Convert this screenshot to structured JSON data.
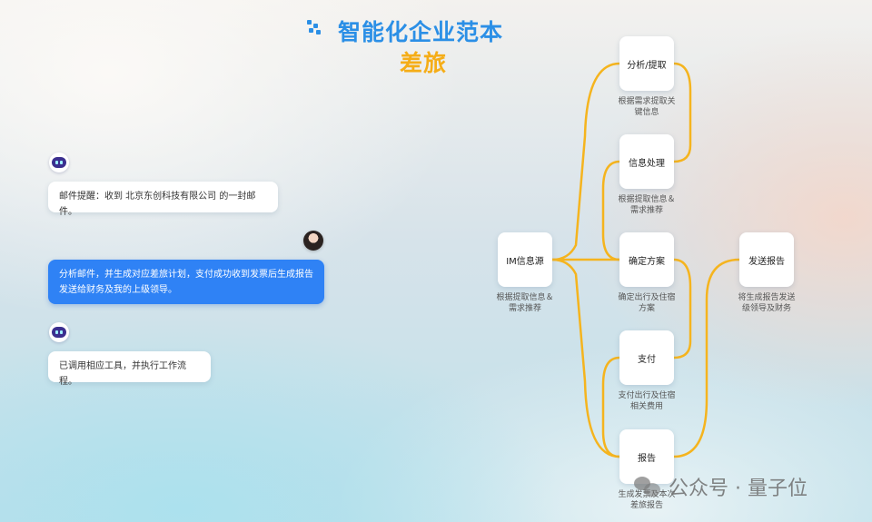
{
  "header": {
    "title": "智能化企业范本",
    "subtitle": "差旅"
  },
  "chat": {
    "messages": [
      {
        "role": "bot",
        "text": "邮件提醒：收到 北京东创科技有限公司 的一封邮件。"
      },
      {
        "role": "user",
        "text_line1": "分析邮件，并生成对应差旅计划，支付成功收到发票后生成报告",
        "text_line2": "发送给财务及我的上级领导。"
      },
      {
        "role": "bot",
        "text": "已调用相应工具，并执行工作流程。"
      }
    ]
  },
  "flow": {
    "source": {
      "label": "IM信息源",
      "caption_line1": "根据提取信息＆",
      "caption_line2": "需求推荐"
    },
    "steps": [
      {
        "label": "分析/提取",
        "caption_line1": "根据需求提取关",
        "caption_line2": "键信息"
      },
      {
        "label": "信息处理",
        "caption_line1": "根据提取信息＆",
        "caption_line2": "需求推荐"
      },
      {
        "label": "确定方案",
        "caption_line1": "确定出行及住宿",
        "caption_line2": "方案"
      },
      {
        "label": "支付",
        "caption_line1": "支付出行及住宿",
        "caption_line2": "相关费用"
      },
      {
        "label": "报告",
        "caption_line1": "生成发票及本次",
        "caption_line2": "差旅报告"
      }
    ],
    "output": {
      "label": "发送报告",
      "caption_line1": "将生成报告发送",
      "caption_line2": "级领导及财务"
    },
    "connector_color": "#f5b41e"
  },
  "watermark": {
    "text": "公众号 · 量子位"
  }
}
